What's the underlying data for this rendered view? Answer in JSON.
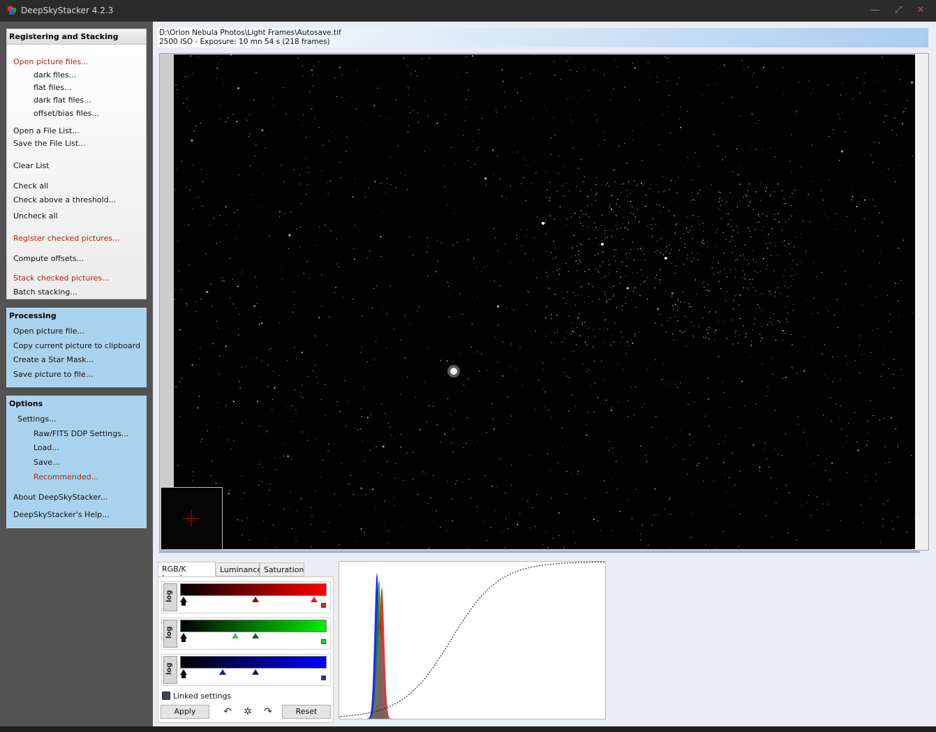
{
  "window": {
    "title": "DeepSkyStacker 4.2.3",
    "minimize_glyph": "—",
    "maximize_glyph": "⤢",
    "close_glyph": "✕"
  },
  "registering": {
    "header": "Registering and Stacking",
    "open_picture_files": "Open picture files...",
    "dark_files": "dark files...",
    "flat_files": "flat files...",
    "dark_flat_files": "dark flat files...",
    "offset_bias_files": "offset/bias files...",
    "open_file_list": "Open a File List...",
    "save_file_list": "Save the File List...",
    "clear_list": "Clear List",
    "check_all": "Check all",
    "check_above_threshold": "Check above a threshold...",
    "uncheck_all": "Uncheck all",
    "register_checked": "Register checked pictures...",
    "compute_offsets": "Compute offsets...",
    "stack_checked": "Stack checked pictures...",
    "batch_stacking": "Batch stacking..."
  },
  "processing": {
    "header": "Processing",
    "open_picture_file": "Open picture file...",
    "copy_to_clipboard": "Copy current picture to clipboard",
    "create_star_mask": "Create a Star Mask...",
    "save_picture": "Save picture to file..."
  },
  "options": {
    "header": "Options",
    "settings": "Settings...",
    "raw_fits": "Raw/FITS DDP Settings...",
    "load": "Load...",
    "save": "Save...",
    "recommended": "Recommended...",
    "about": "About DeepSkyStacker...",
    "help": "DeepSkyStacker's Help..."
  },
  "file_info": {
    "path": "D:\\Orion Nebula Photos\\Light Frames\\Autosave.tif",
    "details": "2500 ISO - Exposure: 10 mn 54 s (218 frames)"
  },
  "levels": {
    "tabs": [
      "RGB/K Levels",
      "Luminance",
      "Saturation"
    ],
    "log_label": "log",
    "linked_settings": "Linked settings",
    "apply": "Apply",
    "reset": "Reset",
    "undo_icon": "undo-icon",
    "settings_icon": "gear-icon",
    "redo_icon": "redo-icon",
    "colors": {
      "red": "#ff0000",
      "green": "#00ee00",
      "blue": "#0000ff"
    }
  },
  "colors": {
    "sidebar_bg": "#535353",
    "panel_blue": "#a9d2ee",
    "accent_red": "#b0280c"
  }
}
